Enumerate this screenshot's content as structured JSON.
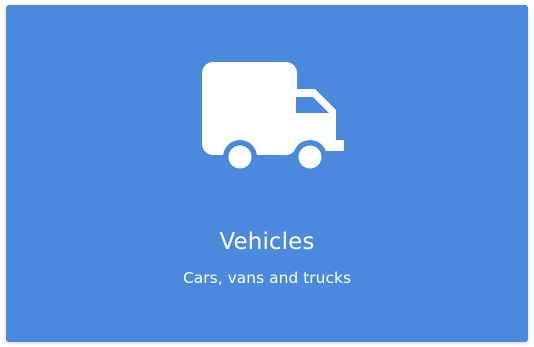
{
  "tile": {
    "icon": "truck-icon",
    "title": "Vehicles",
    "subtitle": "Cars, vans and trucks",
    "background_color": "#4a89dc",
    "text_color": "#ffffff"
  }
}
